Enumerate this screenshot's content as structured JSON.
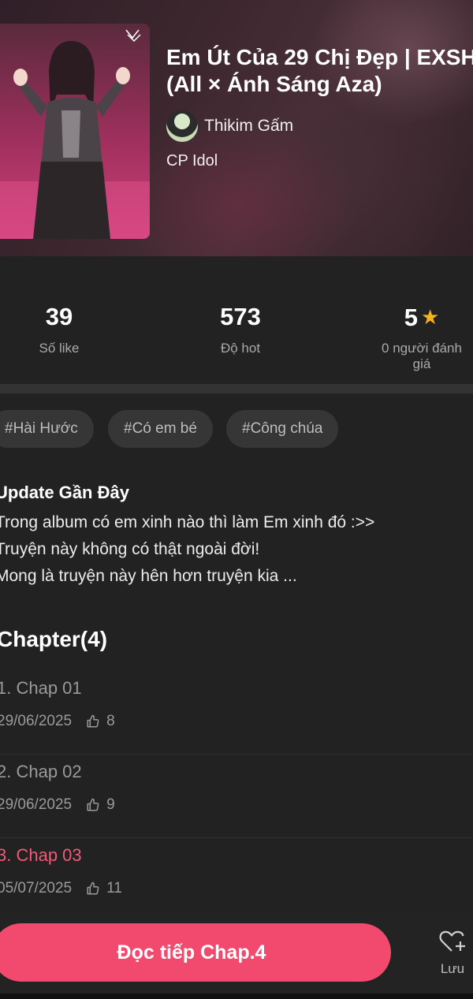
{
  "story": {
    "title_line1": "Em Út Của 29 Chị Đẹp | EXSH",
    "title_line2": "(All × Ánh Sáng Aza)",
    "author": "Thikim Gấm",
    "category": "CP Idol"
  },
  "stats": [
    {
      "value": "39",
      "label": "Số like"
    },
    {
      "value": "573",
      "label": "Độ hot"
    },
    {
      "value": "5",
      "label_line1": "0 người đánh",
      "label_line2": "giá",
      "icon": "star-icon"
    }
  ],
  "tags": [
    "#Hài Hước",
    "#Có em bé",
    "#Công chúa"
  ],
  "description": {
    "title": "Update Gần Đây",
    "lines": [
      "Trong album có em xinh nào thì làm Em xinh đó :>>",
      "Truyện  này không có thật ngoài đời!",
      "Mong là truyện này hên hơn truyện kia ..."
    ]
  },
  "chapters_title": "Chapter(4)",
  "chapters": [
    {
      "name": "1. Chap 01",
      "date": "29/06/2025",
      "likes": "8",
      "current": false
    },
    {
      "name": "2. Chap 02",
      "date": "29/06/2025",
      "likes": "9",
      "current": false
    },
    {
      "name": "3. Chap 03",
      "date": "05/07/2025",
      "likes": "11",
      "current": true
    }
  ],
  "bottom": {
    "read_button": "Đọc tiếp Chap.4",
    "save_label": "Lưu"
  },
  "colors": {
    "accent": "#f24a6e",
    "current_chapter": "#f05a78",
    "star": "#f6b21a",
    "background": "#222222"
  }
}
